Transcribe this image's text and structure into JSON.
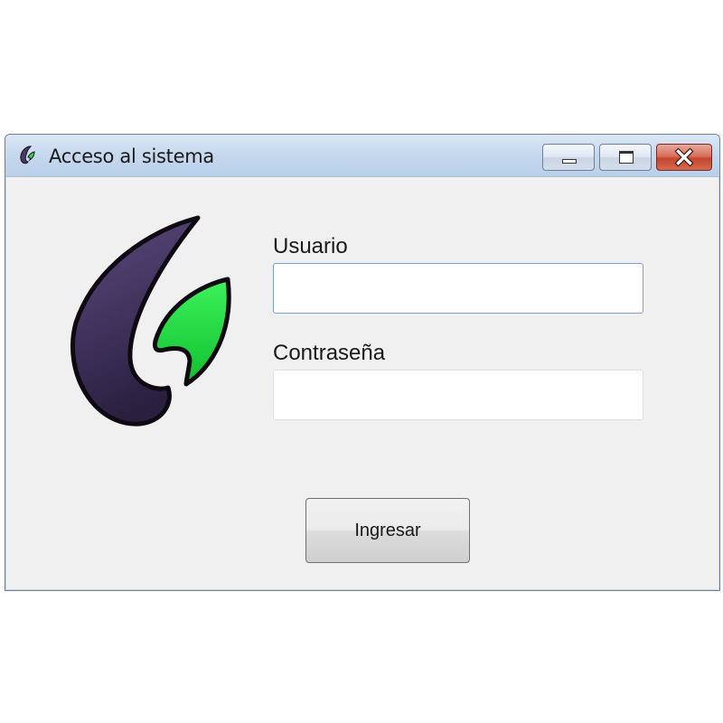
{
  "window": {
    "title": "Acceso al sistema",
    "icon": "app-logo-icon",
    "controls": {
      "minimize": "minimize-icon",
      "maximize": "maximize-icon",
      "close": "close-icon"
    }
  },
  "form": {
    "username_label": "Usuario",
    "username_value": "",
    "password_label": "Contraseña",
    "password_value": "",
    "submit_label": "Ingresar"
  },
  "colors": {
    "logo_purple": "#4a3a6a",
    "logo_green": "#22dd44",
    "title_bar": "#c6d8ee",
    "close_button": "#c5452e"
  }
}
